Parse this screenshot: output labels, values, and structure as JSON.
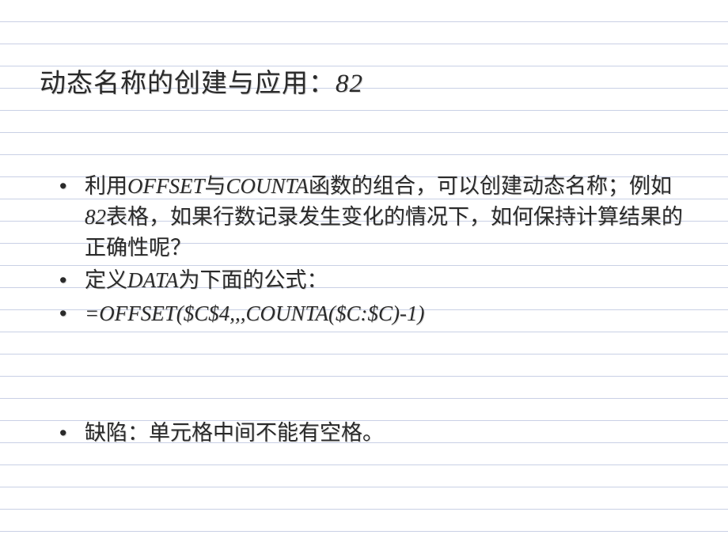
{
  "slide": {
    "title_prefix": "动态名称的创建与应用：",
    "title_number": "82",
    "bullets": [
      {
        "segments": [
          {
            "text": "利用",
            "latin": false
          },
          {
            "text": "OFFSET",
            "latin": true
          },
          {
            "text": "与",
            "latin": false
          },
          {
            "text": "COUNTA",
            "latin": true
          },
          {
            "text": "函数的组合，可以创建动态名称；例如",
            "latin": false
          },
          {
            "text": "82",
            "latin": true
          },
          {
            "text": "表格，如果行数记录发生变化的情况下，如何保持计算结果的正确性呢？",
            "latin": false
          }
        ]
      },
      {
        "segments": [
          {
            "text": "定义",
            "latin": false
          },
          {
            "text": "DATA",
            "latin": true
          },
          {
            "text": "为下面的公式：",
            "latin": false
          }
        ]
      },
      {
        "segments": [
          {
            "text": "=OFFSET($C$4,,,COUNTA($C:$C)-1)",
            "latin": true
          }
        ]
      }
    ],
    "bullets_after_gap": [
      {
        "segments": [
          {
            "text": "缺陷：单元格中间不能有空格。",
            "latin": false
          }
        ]
      }
    ]
  }
}
